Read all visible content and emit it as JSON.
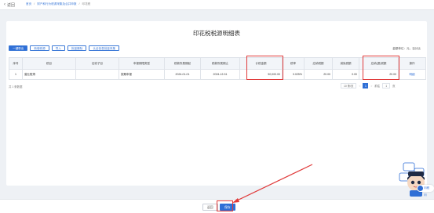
{
  "header": {
    "back_icon": "chevron-left-icon",
    "back_label": "返回",
    "breadcrumbs": [
      "首页",
      "财产和行为税源采集及合并申报",
      "印花税"
    ]
  },
  "page": {
    "title": "印花税税源明细表",
    "unit_label": "金额单位：元，百分比"
  },
  "toolbar": {
    "buttons": [
      "一键带出",
      "新增税源",
      "导入",
      "批量删除",
      "认证信息批量采集"
    ]
  },
  "table": {
    "headers": [
      "序号",
      "税目",
      "征收子目",
      "申报期限类型",
      "税款所属期起",
      "税款所属期止",
      "计税金额",
      "税率",
      "应纳税额",
      "减免税额",
      "应纳(退)税额",
      "操作"
    ],
    "rows": [
      [
        "1",
        "营业账簿",
        "",
        "按期申报",
        "2024-01-01",
        "2024-12-31",
        "50,000.00",
        "0.025%",
        "20.00",
        "0.00",
        "20.00",
        "明细"
      ]
    ]
  },
  "pagination": {
    "total": "共 1 条数据",
    "page_size": "10 条/页",
    "prev": "<",
    "current": "1",
    "next": ">",
    "goto_label": "前往",
    "goto_value": "1",
    "page_unit": "页"
  },
  "footer": {
    "back_label": "返回",
    "save_label": "保存"
  },
  "assistant": {
    "chat_label": "问税问",
    "mascot_icon": "assistant-mascot-icon"
  },
  "colors": {
    "primary": "#2f6fd6",
    "highlight": "#e03a3a"
  }
}
